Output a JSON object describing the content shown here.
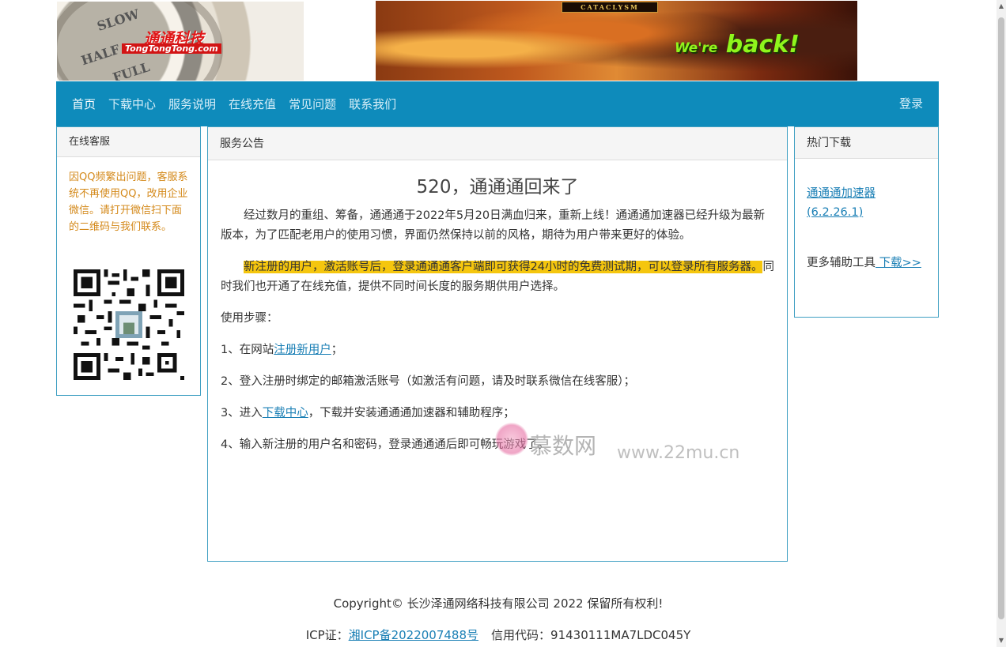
{
  "banner": {
    "logo_cn": "通通科技",
    "logo_en": "TongTongTong.com",
    "dial_words": [
      "SLOW",
      "HALF",
      "FULL"
    ],
    "game_badge": "CATACLYSM",
    "game_slogan_small": "We're",
    "game_slogan_big": "back!"
  },
  "nav": {
    "items": [
      "首页",
      "下载中心",
      "服务说明",
      "在线充值",
      "常见问题",
      "联系我们"
    ],
    "login": "登录"
  },
  "left_panel": {
    "title": "在线客服",
    "notice": "因QQ频繁出问题，客服系统不再使用QQ，改用企业微信。请打开微信扫下面的二维码与我们联系。"
  },
  "center_panel": {
    "title": "服务公告",
    "headline": "520，通通通回来了",
    "para1": "经过数月的重组、筹备，通通通于2022年5月20日满血归来，重新上线！通通通加速器已经升级为最新版本，为了匹配老用户的使用习惯，界面仍然保持以前的风格，期待为用户带来更好的体验。",
    "para2_highlight": "新注册的用户，激活账号后，登录通通通客户端即可获得24小时的免费测试期，可以登录所有服务器。",
    "para2_rest": "同时我们也开通了在线充值，提供不同时间长度的服务期供用户选择。",
    "steps_label": "使用步骤：",
    "step1_pre": "1、在网站",
    "step1_link": "注册新用户",
    "step1_post": "；",
    "step2": "2、登入注册时绑定的邮箱激活账号（如激活有问题，请及时联系微信在线客服）；",
    "step3_pre": "3、进入",
    "step3_link": "下载中心",
    "step3_post": "，下载并安装通通通加速器和辅助程序；",
    "step4": "4、输入新注册的用户名和密码，登录通通通后即可畅玩游戏了。"
  },
  "right_panel": {
    "title": "热门下载",
    "download_link": "通通通加速器(6.2.26.1)",
    "more_text": "更多辅助工具",
    "more_link": " 下载>>"
  },
  "watermark": {
    "cn": "慕数网",
    "en": "www.22mu.cn"
  },
  "footer": {
    "copyright": "Copyright© 长沙泽通网络科技有限公司 2022 保留所有权利!",
    "icp_label": "ICP证：",
    "icp_link": "湘ICP备2022007488号",
    "credit": "信用代码：91430111MA7LDC045Y"
  },
  "colors": {
    "nav_bg": "#0e8bbb",
    "panel_border": "#3f9fc2",
    "notice_text": "#d4891a",
    "highlight": "#f5c60e",
    "link": "#1a7fb5"
  }
}
